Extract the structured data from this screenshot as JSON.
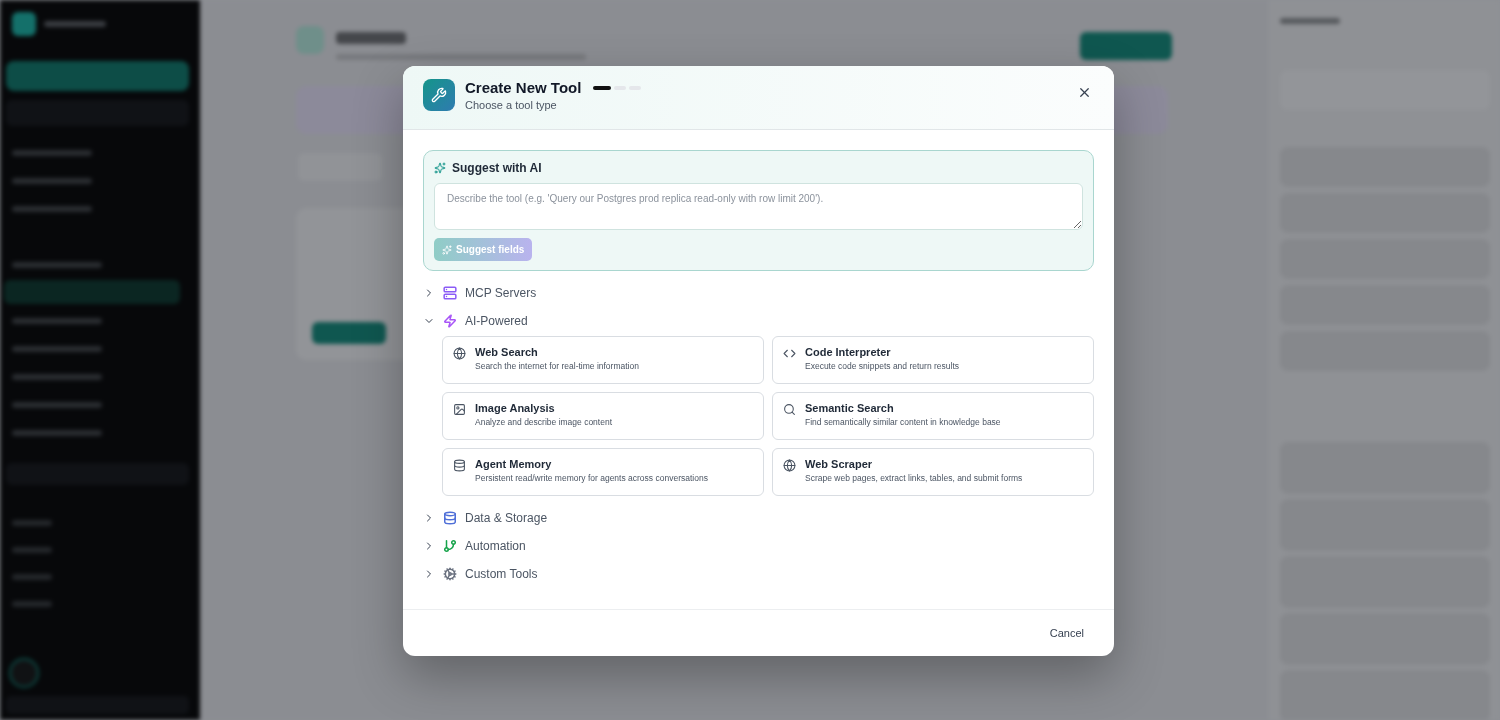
{
  "modal": {
    "title": "Create New Tool",
    "subtitle": "Choose a tool type",
    "steps": [
      {
        "selected": true
      },
      {
        "selected": false
      },
      {
        "selected": false
      }
    ],
    "suggest": {
      "title": "Suggest with AI",
      "placeholder": "Describe the tool (e.g. 'Query our Postgres prod replica read-only with row limit 200').",
      "button": {
        "label": "Suggest fields",
        "disabled": true
      }
    },
    "categories": [
      {
        "label": "MCP Servers",
        "expanded": false,
        "color": "#8b5cf6"
      },
      {
        "label": "AI-Powered",
        "expanded": true,
        "color": "#a855f7",
        "tools": [
          {
            "name": "Web Search",
            "description": "Search the internet for real-time information"
          },
          {
            "name": "Code Interpreter",
            "description": "Execute code snippets and return results"
          },
          {
            "name": "Image Analysis",
            "description": "Analyze and describe image content"
          },
          {
            "name": "Semantic Search",
            "description": "Find semantically similar content in knowledge base"
          },
          {
            "name": "Agent Memory",
            "description": "Persistent read/write memory for agents across conversations"
          },
          {
            "name": "Web Scraper",
            "description": "Scrape web pages, extract links, tables, and submit forms"
          }
        ]
      },
      {
        "label": "Data & Storage",
        "expanded": false,
        "color": "#4f6fd8"
      },
      {
        "label": "Automation",
        "expanded": false,
        "color": "#16a34a"
      },
      {
        "label": "Custom Tools",
        "expanded": false,
        "color": "#6b7280"
      }
    ],
    "cancel": "Cancel"
  }
}
